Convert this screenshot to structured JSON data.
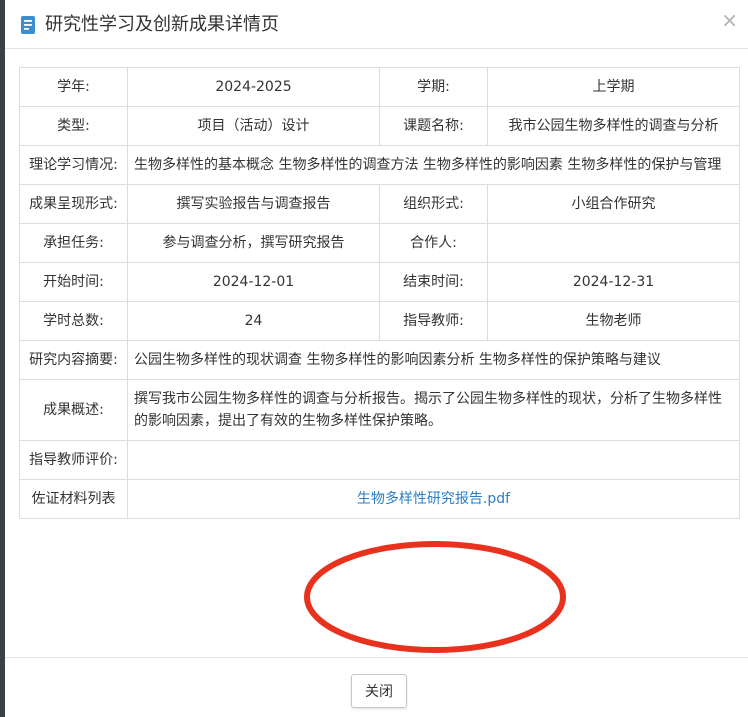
{
  "dialog": {
    "title": "研究性学习及创新成果详情页",
    "close_glyph": "×",
    "icon": "document-icon"
  },
  "details": {
    "school_year_label": "学年:",
    "school_year_value": "2024-2025",
    "semester_label": "学期:",
    "semester_value": "上学期",
    "type_label": "类型:",
    "type_value": "项目（活动）设计",
    "topic_label": "课题名称:",
    "topic_value": "我市公园生物多样性的调查与分析",
    "theory_label": "理论学习情况:",
    "theory_value": "生物多样性的基本概念 生物多样性的调查方法 生物多样性的影响因素 生物多样性的保护与管理",
    "result_form_label": "成果呈现形式:",
    "result_form_value": "撰写实验报告与调查报告",
    "org_form_label": "组织形式:",
    "org_form_value": "小组合作研究",
    "task_label": "承担任务:",
    "task_value": "参与调查分析，撰写研究报告",
    "partner_label": "合作人:",
    "partner_value": "",
    "start_label": "开始时间:",
    "start_value": "2024-12-01",
    "end_label": "结束时间:",
    "end_value": "2024-12-31",
    "hours_label": "学时总数:",
    "hours_value": "24",
    "teacher_label": "指导教师:",
    "teacher_value": "生物老师",
    "abstract_label": "研究内容摘要:",
    "abstract_value": "公园生物多样性的现状调查 生物多样性的影响因素分析 生物多样性的保护策略与建议",
    "summary_label": "成果概述:",
    "summary_value": "撰写我市公园生物多样性的调查与分析报告。揭示了公园生物多样性的现状，分析了生物多样性的影响因素，提出了有效的生物多样性保护策略。",
    "teacher_comment_label": "指导教师评价:",
    "teacher_comment_value": "",
    "evidence_label": "佐证材料列表",
    "evidence_file": "生物多样性研究报告.pdf"
  },
  "annotation": {
    "ellipse_color": "#e8321e"
  },
  "footer": {
    "close_label": "关闭"
  }
}
